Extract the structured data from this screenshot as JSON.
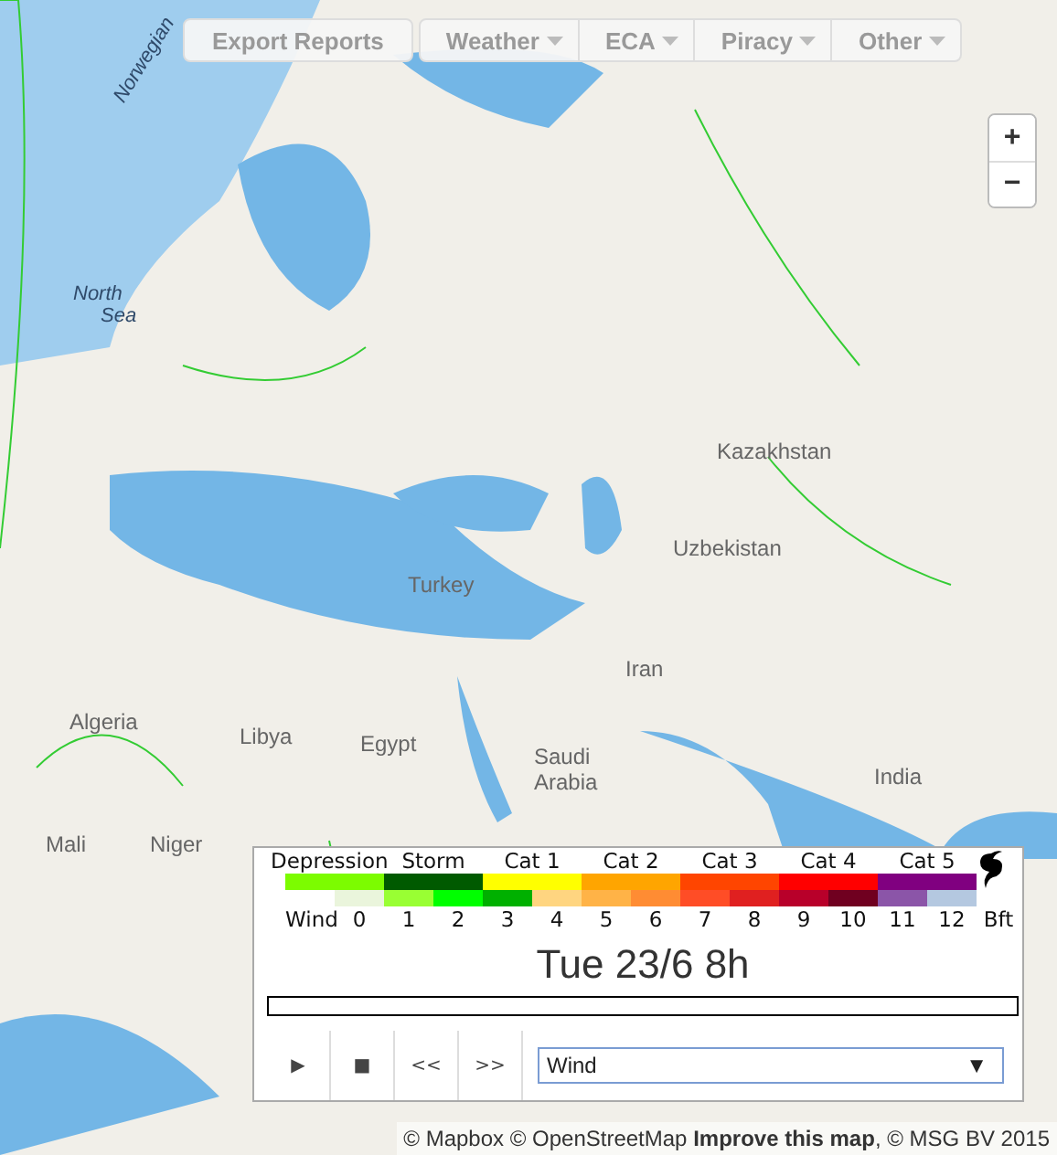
{
  "toolbar": {
    "export_button": "Export Reports",
    "menus": [
      {
        "label": "Weather"
      },
      {
        "label": "ECA"
      },
      {
        "label": "Piracy"
      },
      {
        "label": "Other"
      }
    ]
  },
  "zoom": {
    "in": "+",
    "out": "−"
  },
  "map_labels": [
    {
      "text": "Norwegian",
      "kind": "sea",
      "rotated": true
    },
    {
      "text": "North",
      "kind": "sea",
      "rotated": false
    },
    {
      "text": "Sea",
      "kind": "sea",
      "rotated": false
    },
    {
      "text": "Kazakhstan",
      "kind": "land",
      "rotated": false
    },
    {
      "text": "Uzbekistan",
      "kind": "land",
      "rotated": false
    },
    {
      "text": "Turkey",
      "kind": "land",
      "rotated": false
    },
    {
      "text": "Iran",
      "kind": "land",
      "rotated": false
    },
    {
      "text": "Algeria",
      "kind": "land",
      "rotated": false
    },
    {
      "text": "Libya",
      "kind": "land",
      "rotated": false
    },
    {
      "text": "Egypt",
      "kind": "land",
      "rotated": false
    },
    {
      "text": "Saudi",
      "kind": "land",
      "rotated": false
    },
    {
      "text": "Arabia",
      "kind": "land",
      "rotated": false
    },
    {
      "text": "India",
      "kind": "land",
      "rotated": false
    },
    {
      "text": "Mali",
      "kind": "land",
      "rotated": false
    },
    {
      "text": "Niger",
      "kind": "land",
      "rotated": false
    }
  ],
  "legend": {
    "categories": [
      {
        "label": "Depression",
        "color": "#7cfc00"
      },
      {
        "label": "Storm",
        "color": "#005a00"
      },
      {
        "label": "Cat 1",
        "color": "#ffff00"
      },
      {
        "label": "Cat 2",
        "color": "#ffa500"
      },
      {
        "label": "Cat 3",
        "color": "#ff4500"
      },
      {
        "label": "Cat 4",
        "color": "#ff0000"
      },
      {
        "label": "Cat 5",
        "color": "#800080"
      }
    ],
    "wind_label": "Wind",
    "beaufort": [
      {
        "label": "0",
        "color": "#eaf5dc"
      },
      {
        "label": "1",
        "color": "#99ff33"
      },
      {
        "label": "2",
        "color": "#00ff00"
      },
      {
        "label": "3",
        "color": "#00b000"
      },
      {
        "label": "4",
        "color": "#ffd580"
      },
      {
        "label": "5",
        "color": "#ffb347"
      },
      {
        "label": "6",
        "color": "#ff8c33"
      },
      {
        "label": "7",
        "color": "#ff4d26"
      },
      {
        "label": "8",
        "color": "#e02020"
      },
      {
        "label": "9",
        "color": "#b8002a"
      },
      {
        "label": "10",
        "color": "#700020"
      },
      {
        "label": "11",
        "color": "#8b55a8"
      },
      {
        "label": "12",
        "color": "#b4c8e0"
      }
    ],
    "unit": "Bft"
  },
  "time": "Tue 23/6 8h",
  "controls": [
    "▶",
    "■",
    "<<",
    ">>"
  ],
  "layer_select": {
    "value": "Wind",
    "arrow": "▼"
  },
  "attribution": {
    "prefix": "© Mapbox © OpenStreetMap",
    "link": "Improve this map",
    "suffix": ", © MSG BV 2015"
  }
}
